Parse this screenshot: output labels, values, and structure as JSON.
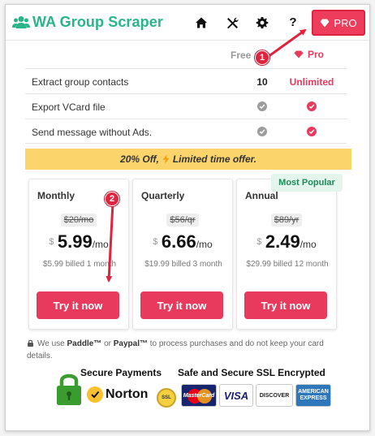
{
  "header": {
    "title": "WA Group Scraper",
    "icons": [
      "home-icon",
      "tools-icon",
      "gear-icon",
      "help-icon"
    ],
    "help_glyph": "?",
    "pro_label": "PRO"
  },
  "comparison": {
    "col_free": "Free",
    "col_pro": "Pro",
    "rows": [
      {
        "label": "Extract group contacts",
        "free": "10",
        "pro": "Unlimited"
      },
      {
        "label": "Export VCard file",
        "free_icon": "check-circle-icon",
        "pro_icon": "check-circle-icon"
      },
      {
        "label": "Send message without Ads.",
        "free_icon": "check-circle-icon",
        "pro_icon": "check-circle-icon"
      }
    ]
  },
  "promo": {
    "before": "20% Off,",
    "after": "Limited time offer."
  },
  "popular_badge": "Most Popular",
  "plans": [
    {
      "name": "Monthly",
      "old_price": "$20/mo",
      "currency": "$",
      "price": "5.99",
      "per": "/mo",
      "billed": "$5.99 billed 1 month",
      "button": "Try it now"
    },
    {
      "name": "Quarterly",
      "old_price": "$56/qr",
      "currency": "$",
      "price": "6.66",
      "per": "/mo",
      "billed": "$19.99 billed 3 month",
      "button": "Try it now"
    },
    {
      "name": "Annual",
      "old_price": "$89/yr",
      "currency": "$",
      "price": "2.49",
      "per": "/mo",
      "billed": "$29.99 billed 12 month",
      "button": "Try it now"
    }
  ],
  "notice": {
    "pre": "We use ",
    "paddle": "Paddle™",
    "or": " or ",
    "paypal": "Paypal™",
    "post": " to process purchases and do not keep your card details."
  },
  "badges": {
    "secure_payments": "Secure Payments",
    "ssl": "Safe and Secure SSL Encrypted",
    "norton": "Norton",
    "seal_text": "SSL",
    "mastercard": "MasterCard",
    "visa": "VISA",
    "discover": "DISCOVER",
    "amex_line1": "AMERICAN",
    "amex_line2": "EXPRESS"
  },
  "annotations": {
    "marker_1": "1",
    "marker_2": "2",
    "color": "#e0243f"
  },
  "colors": {
    "brand": "#29b48a",
    "accent": "#e73a5c",
    "promo": "#fbd56c"
  }
}
